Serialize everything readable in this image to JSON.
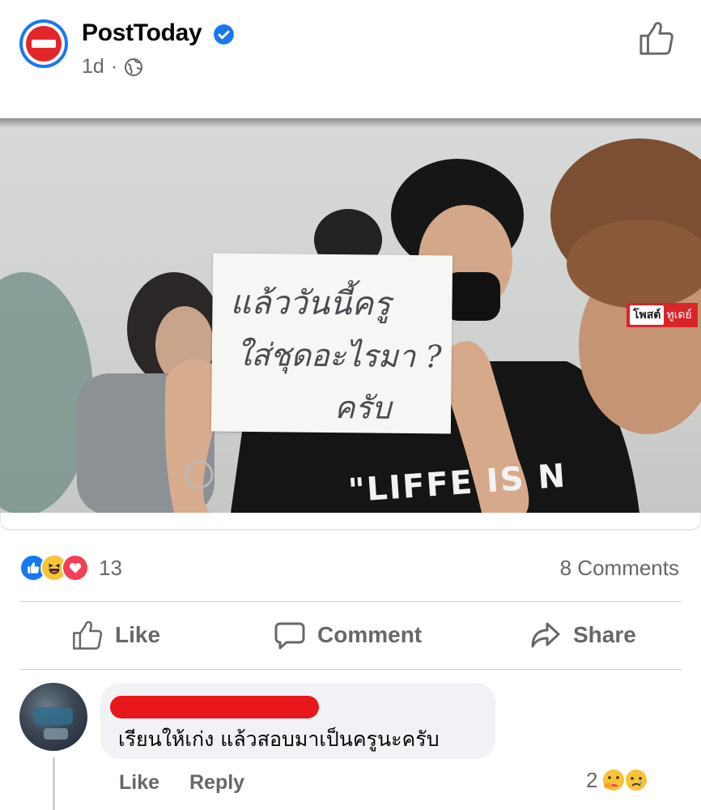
{
  "post": {
    "page_name": "PostToday",
    "time": "1d",
    "separator": "·",
    "photo": {
      "sign_text": [
        "แล้ววันนี้ครู",
        "ใส่ชุดอะไรมา ?",
        "ครับ"
      ],
      "shirt_text": "\"LIFFE IS N",
      "watermark_box": "โพสต์",
      "watermark_text": "ทูเดย์"
    },
    "reactions": {
      "icons": [
        "like-icon",
        "haha-icon",
        "love-icon"
      ],
      "count": "13"
    },
    "comments_count": "8 Comments",
    "actions": {
      "like": "Like",
      "comment": "Comment",
      "share": "Share"
    }
  },
  "comment": {
    "text": "เรียนให้เก่ง แล้วสอบมาเป็นครูนะครับ",
    "like_label": "Like",
    "reply_label": "Reply",
    "reaction_count": "2",
    "reaction_icons": [
      "care-icon",
      "sad-icon"
    ]
  },
  "colors": {
    "facebook_blue": "#1877f2",
    "secondary_text": "#65676b",
    "brand_red": "#e4262b",
    "redaction_red": "#e8171c",
    "bubble_bg": "#f0f2f5"
  }
}
